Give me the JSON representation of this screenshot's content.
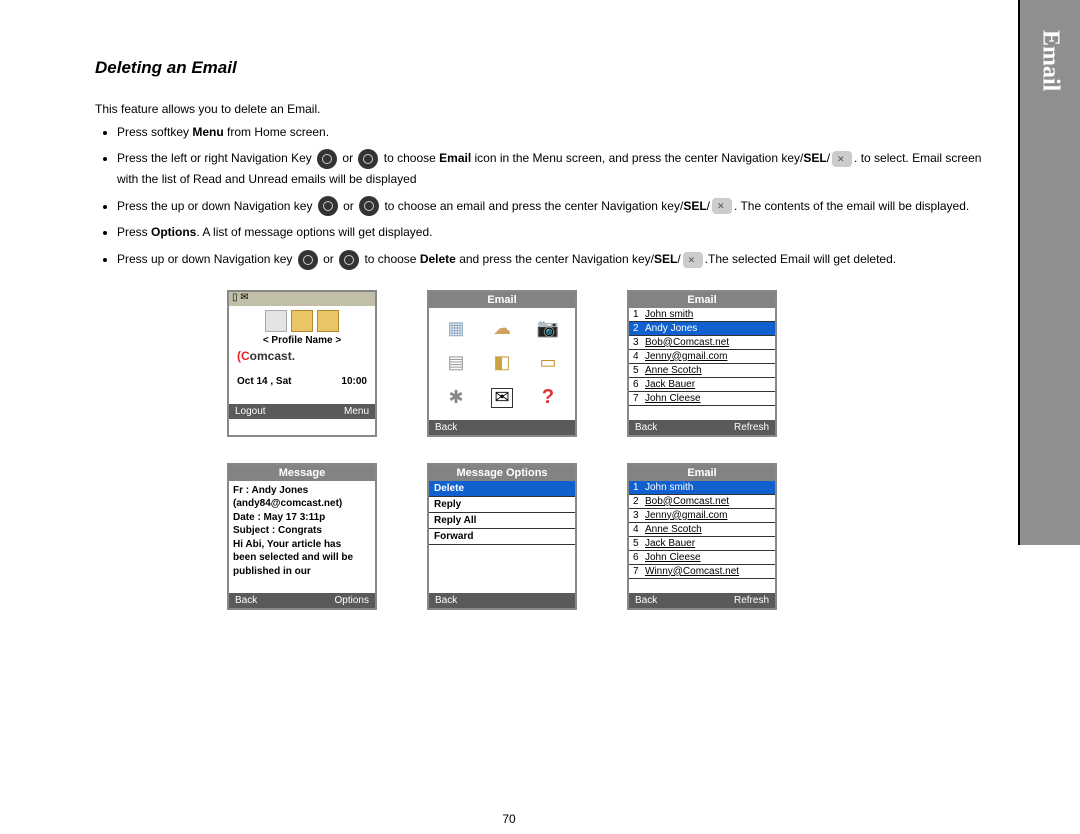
{
  "page_number": "70",
  "sidebar_tab": "Email",
  "section_title": "Deleting an Email",
  "intro": "This feature allows you to delete an Email.",
  "steps": {
    "s1_a": "Press softkey ",
    "s1_bold": "Menu",
    "s1_b": " from Home screen.",
    "s2_a": "Press the left or right Navigation Key ",
    "s2_or": " or ",
    "s2_b": " to choose ",
    "s2_bold": "Email",
    "s2_c": " icon in the Menu screen, and press the center Navigation key/",
    "s2_sel": "SEL",
    "s2_d": ". to select. Email screen with the list of Read and Unread emails will be displayed",
    "s3_a": "Press the up or down Navigation key ",
    "s3_or": " or ",
    "s3_b": " to choose an email and press the center Navigation key/",
    "s3_sel": "SEL",
    "s3_c": ". The contents of the email will be displayed.",
    "s4_a": "Press ",
    "s4_bold": "Options",
    "s4_b": ". A list of message options will get displayed.",
    "s5_a": "Press up or down Navigation key ",
    "s5_or": " or ",
    "s5_b": " to choose ",
    "s5_bold": "Delete",
    "s5_c": " and press the center Navigation key/",
    "s5_sel": "SEL",
    "s5_d": ".The selected Email will get deleted."
  },
  "screens": {
    "home": {
      "profile_text": "< Profile Name >",
      "logo_pre": "C",
      "logo_rest": "omcast.",
      "date": "Oct 14 , Sat",
      "time": "10:00",
      "left_soft": "Logout",
      "right_soft": "Menu"
    },
    "menu": {
      "title": "Email",
      "left_soft": "Back",
      "right_soft": ""
    },
    "email_list1": {
      "title": "Email",
      "items": [
        {
          "n": "1",
          "name": "John smith",
          "sel": false
        },
        {
          "n": "2",
          "name": "Andy Jones",
          "sel": true
        },
        {
          "n": "3",
          "name": "Bob@Comcast.net",
          "sel": false
        },
        {
          "n": "4",
          "name": "Jenny@gmail.com",
          "sel": false
        },
        {
          "n": "5",
          "name": "Anne Scotch",
          "sel": false
        },
        {
          "n": "6",
          "name": "Jack Bauer",
          "sel": false
        },
        {
          "n": "7",
          "name": "John Cleese",
          "sel": false
        }
      ],
      "left_soft": "Back",
      "right_soft": "Refresh"
    },
    "message": {
      "title": "Message",
      "from_line": "Fr : Andy Jones",
      "from_addr": "(andy84@comcast.net)",
      "date_line": "Date : May 17 3:11p",
      "subject_line": "Subject : Congrats",
      "body_line1": "Hi Abi,  Your article has",
      "body_line2": "been selected and will be",
      "body_line3": "published in our",
      "left_soft": "Back",
      "right_soft": "Options"
    },
    "options": {
      "title": "Message Options",
      "items": [
        {
          "label": "Delete",
          "sel": true
        },
        {
          "label": "Reply",
          "sel": false
        },
        {
          "label": "Reply All",
          "sel": false
        },
        {
          "label": "Forward",
          "sel": false
        }
      ],
      "left_soft": "Back",
      "right_soft": ""
    },
    "email_list2": {
      "title": "Email",
      "items": [
        {
          "n": "1",
          "name": "John smith",
          "sel": true
        },
        {
          "n": "2",
          "name": "Bob@Comcast.net",
          "sel": false
        },
        {
          "n": "3",
          "name": "Jenny@gmail.com",
          "sel": false
        },
        {
          "n": "4",
          "name": "Anne Scotch",
          "sel": false
        },
        {
          "n": "5",
          "name": "Jack Bauer",
          "sel": false
        },
        {
          "n": "6",
          "name": "John Cleese",
          "sel": false
        },
        {
          "n": "7",
          "name": "Winny@Comcast.net",
          "sel": false
        }
      ],
      "left_soft": "Back",
      "right_soft": "Refresh"
    }
  }
}
